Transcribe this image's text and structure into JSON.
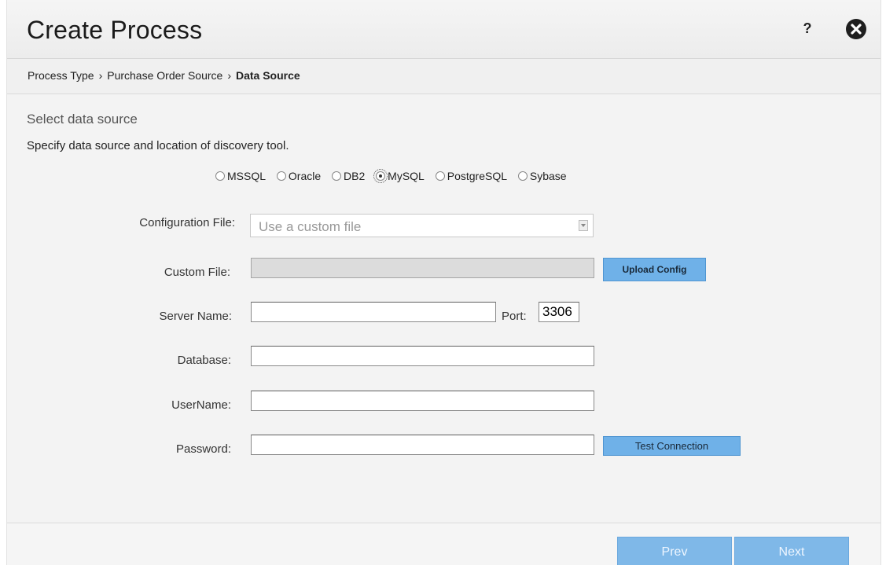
{
  "header": {
    "title": "Create Process",
    "help_label": "?",
    "close_icon": "close-circle-icon"
  },
  "breadcrumb": {
    "items": [
      {
        "label": "Process Type",
        "current": false
      },
      {
        "label": "Purchase Order Source",
        "current": false
      },
      {
        "label": "Data Source",
        "current": true
      }
    ],
    "separator": "›"
  },
  "section": {
    "title": "Select data source",
    "description": "Specify data source and location of discovery tool."
  },
  "db_types": {
    "options": [
      "MSSQL",
      "Oracle",
      "DB2",
      "MySQL",
      "PostgreSQL",
      "Sybase"
    ],
    "selected": "MySQL"
  },
  "form": {
    "config_file": {
      "label": "Configuration File:",
      "value": "Use a custom file"
    },
    "custom_file": {
      "label": "Custom File:",
      "value": ""
    },
    "upload_button": "Upload Config",
    "server_name": {
      "label": "Server Name:",
      "value": ""
    },
    "port": {
      "label": "Port:",
      "value": "3306"
    },
    "database": {
      "label": "Database:",
      "value": ""
    },
    "username": {
      "label": "UserName:",
      "value": ""
    },
    "password": {
      "label": "Password:",
      "value": ""
    },
    "test_button": "Test Connection"
  },
  "footer": {
    "prev_label": "Prev",
    "next_label": "Next"
  },
  "colors": {
    "accent_button": "#6fb1e8",
    "nav_button": "#7fb8e8"
  }
}
